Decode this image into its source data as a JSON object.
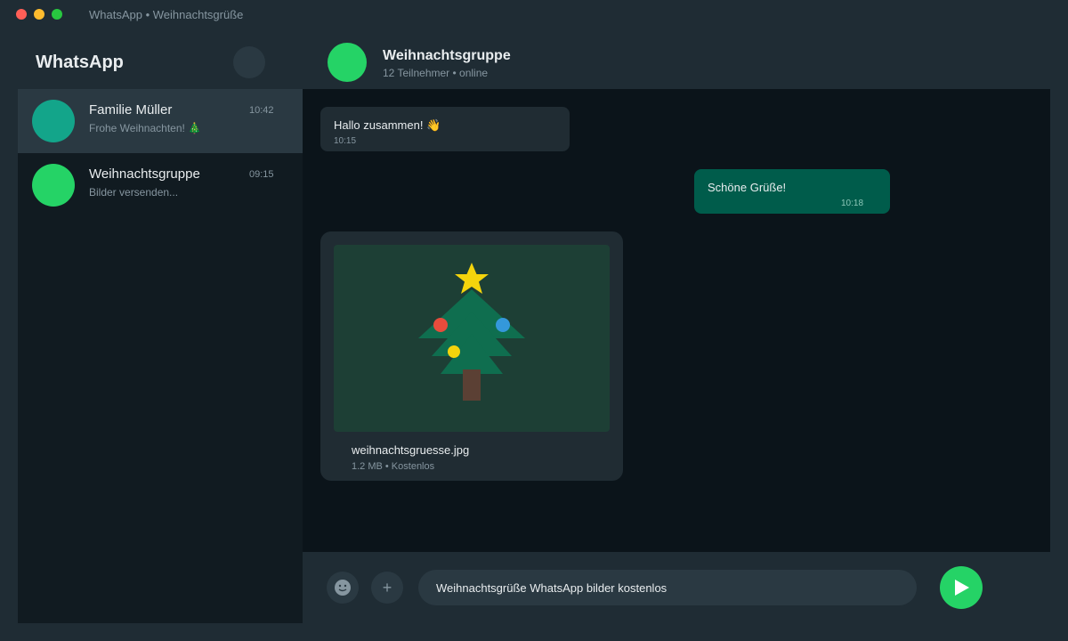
{
  "window": {
    "title": "WhatsApp • Weihnachtsgrüße"
  },
  "sidebar": {
    "title": "WhatsApp",
    "chats": [
      {
        "name": "Familie Müller",
        "time": "10:42",
        "preview": "Frohe Weihnachten! 🎄",
        "avatar_color": "#13a58a",
        "active": true
      },
      {
        "name": "Weihnachtsgruppe",
        "time": "09:15",
        "preview": "Bilder versenden...",
        "avatar_color": "#25d366",
        "active": false
      }
    ]
  },
  "chat": {
    "name": "Weihnachtsgruppe",
    "subtitle": "12 Teilnehmer • online",
    "messages": [
      {
        "direction": "in",
        "text": "Hallo zusammen! 👋",
        "time": "10:15"
      },
      {
        "direction": "out",
        "text": "Schöne Grüße!",
        "time": "10:18"
      },
      {
        "direction": "in",
        "type": "image",
        "icon": "christmas-tree",
        "file_name": "weihnachtsgruesse.jpg",
        "file_meta": "1.2 MB • Kostenlos"
      }
    ]
  },
  "composer": {
    "value": "Weihnachtsgrüße WhatsApp bilder kostenlos",
    "attach_icon": "+"
  },
  "colors": {
    "accent": "#25d366",
    "outgoing_bubble": "#005c4b",
    "incoming_bubble": "#202c33"
  }
}
